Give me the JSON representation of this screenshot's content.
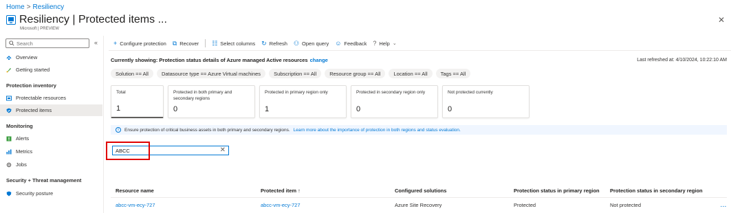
{
  "breadcrumb": {
    "home": "Home",
    "separator": ">",
    "current": "Resiliency"
  },
  "header": {
    "title": "Resiliency | Protected items ...",
    "subtitle": "Microsoft | PREVIEW"
  },
  "sidebar": {
    "search_placeholder": "Search",
    "items": [
      {
        "label": "Overview",
        "icon": "overview-icon"
      },
      {
        "label": "Getting started",
        "icon": "rocket-icon"
      }
    ],
    "sections": [
      {
        "title": "Protection inventory",
        "items": [
          {
            "label": "Protectable resources",
            "icon": "protectable-resources-icon"
          },
          {
            "label": "Protected items",
            "icon": "protected-items-icon",
            "active": true
          }
        ]
      },
      {
        "title": "Monitoring",
        "items": [
          {
            "label": "Alerts",
            "icon": "alerts-icon"
          },
          {
            "label": "Metrics",
            "icon": "metrics-icon"
          },
          {
            "label": "Jobs",
            "icon": "jobs-icon"
          }
        ]
      },
      {
        "title": "Security + Threat management",
        "items": [
          {
            "label": "Security posture",
            "icon": "shield-icon"
          }
        ]
      }
    ]
  },
  "toolbar": {
    "configure_protection": "Configure protection",
    "recover": "Recover",
    "select_columns": "Select columns",
    "refresh": "Refresh",
    "open_query": "Open query",
    "feedback": "Feedback",
    "help": "Help"
  },
  "status": {
    "currently_showing": "Currently showing: Protection status details of Azure managed Active resources",
    "change": "change",
    "last_refreshed": "Last refreshed at: 4/10/2024, 10:22:10 AM"
  },
  "filters": [
    "Solution == All",
    "Datasource type == Azure Virtual machines",
    "Subscription == All",
    "Resource group == All",
    "Location == All",
    "Tags == All"
  ],
  "cards": [
    {
      "label": "Total",
      "value": "1"
    },
    {
      "label": "Protected in both primary and secondary regions",
      "value": "0"
    },
    {
      "label": "Protected in primary region only",
      "value": "1"
    },
    {
      "label": "Protected in secondary region only",
      "value": "0"
    },
    {
      "label": "Not protected currently",
      "value": "0"
    }
  ],
  "info": {
    "text": "Ensure protection of critical business assets in both primary and secondary regions.",
    "link": "Learn more about the importance of protection in both regions and status evaluation."
  },
  "search_filter": {
    "value": "ABCC"
  },
  "table": {
    "columns": [
      "Resource name",
      "Protected item ↑",
      "Configured solutions",
      "Protection status in primary region",
      "Protection status in secondary region"
    ],
    "rows": [
      {
        "resource_name": "abcc-vm-ecy-727",
        "protected_item": "abcc-vm-ecy-727",
        "configured_solutions": "Azure Site Recovery",
        "primary_status": "Protected",
        "secondary_status": "Not protected",
        "more": "..."
      }
    ]
  },
  "colors": {
    "accent": "#0078d4",
    "highlight": "#e00000"
  }
}
